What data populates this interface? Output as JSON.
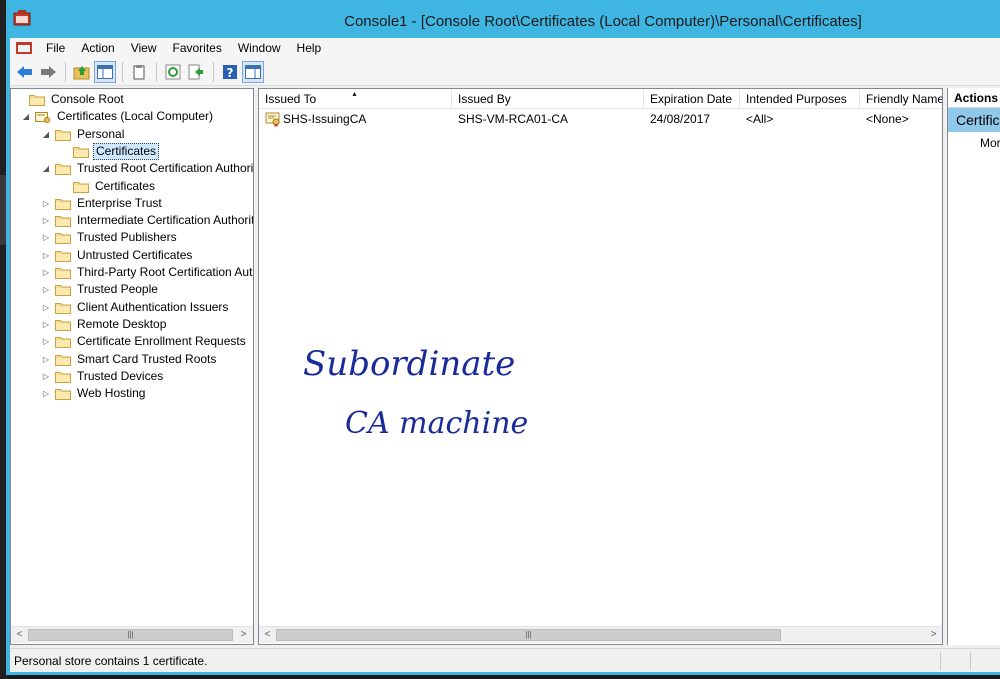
{
  "window": {
    "title": "Console1 - [Console Root\\Certificates (Local Computer)\\Personal\\Certificates]"
  },
  "menu": {
    "items": [
      "File",
      "Action",
      "View",
      "Favorites",
      "Window",
      "Help"
    ]
  },
  "toolbar": {
    "buttons": [
      "back-icon",
      "forward-icon",
      "up-folder-icon",
      "show-hide-tree-icon",
      "copy-icon",
      "refresh-icon",
      "export-list-icon",
      "help-icon",
      "show-hide-action-pane-icon"
    ]
  },
  "tree": {
    "items": [
      {
        "label": "Console Root",
        "level": 0,
        "expander": ""
      },
      {
        "label": "Certificates (Local Computer)",
        "level": 1,
        "expander": "◢"
      },
      {
        "label": "Personal",
        "level": 2,
        "expander": "◢"
      },
      {
        "label": "Certificates",
        "level": 3,
        "expander": "",
        "selected": true
      },
      {
        "label": "Trusted Root Certification Authorities",
        "level": 2,
        "expander": "◢"
      },
      {
        "label": "Certificates",
        "level": 3,
        "expander": ""
      },
      {
        "label": "Enterprise Trust",
        "level": 2,
        "expander": "▷"
      },
      {
        "label": "Intermediate Certification Authorities",
        "level": 2,
        "expander": "▷"
      },
      {
        "label": "Trusted Publishers",
        "level": 2,
        "expander": "▷"
      },
      {
        "label": "Untrusted Certificates",
        "level": 2,
        "expander": "▷"
      },
      {
        "label": "Third-Party Root Certification Authorities",
        "level": 2,
        "expander": "▷"
      },
      {
        "label": "Trusted People",
        "level": 2,
        "expander": "▷"
      },
      {
        "label": "Client Authentication Issuers",
        "level": 2,
        "expander": "▷"
      },
      {
        "label": "Remote Desktop",
        "level": 2,
        "expander": "▷"
      },
      {
        "label": "Certificate Enrollment Requests",
        "level": 2,
        "expander": "▷"
      },
      {
        "label": "Smart Card Trusted Roots",
        "level": 2,
        "expander": "▷"
      },
      {
        "label": "Trusted Devices",
        "level": 2,
        "expander": "▷"
      },
      {
        "label": "Web Hosting",
        "level": 2,
        "expander": "▷"
      }
    ]
  },
  "list": {
    "columns": [
      "Issued To",
      "Issued By",
      "Expiration Date",
      "Intended Purposes",
      "Friendly Name"
    ],
    "rows": [
      {
        "issued_to": "SHS-IssuingCA",
        "issued_by": "SHS-VM-RCA01-CA",
        "expiration": "24/08/2017",
        "purposes": "<All>",
        "friendly": "<None>"
      }
    ],
    "annotation": [
      "Subordinate",
      "CA machine"
    ]
  },
  "actions": {
    "header": "Actions",
    "section": "Certificates",
    "more": "More Actions"
  },
  "status": {
    "text": "Personal store contains 1 certificate."
  },
  "colors": {
    "titlebar": "#3fb5e2",
    "selection": "#cde8ff",
    "actions_section": "#8fc8e8",
    "handwriting_ink": "#1a2a9a"
  }
}
